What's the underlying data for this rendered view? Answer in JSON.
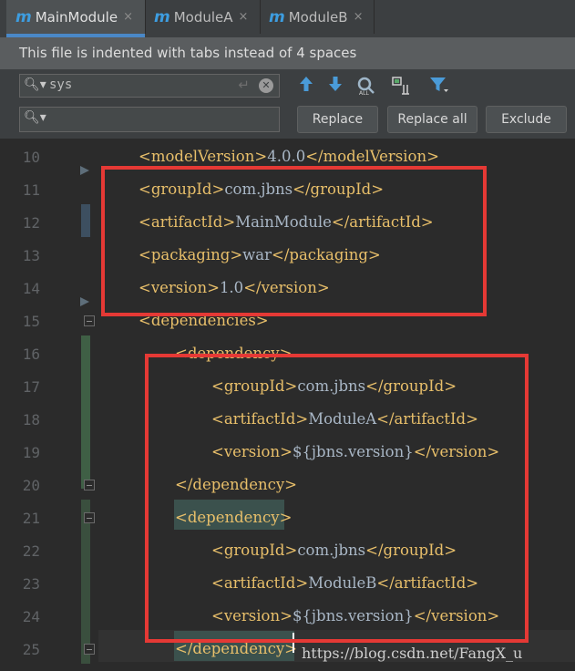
{
  "tabs": [
    {
      "name": "MainModule",
      "icon": "m-module-icon",
      "active": true
    },
    {
      "name": "ModuleA",
      "icon": "m-module-icon",
      "active": false
    },
    {
      "name": "ModuleB",
      "icon": "m-module-icon",
      "active": false
    }
  ],
  "tab_close_glyph": "×",
  "tab_module_glyph": "m",
  "banner": {
    "text": "This file is indented with tabs instead of 4 spaces"
  },
  "search": {
    "value": "sys",
    "placeholder": ""
  },
  "replace": {
    "value": "",
    "placeholder": ""
  },
  "buttons": {
    "replace": "Replace",
    "replace_all": "Replace all",
    "exclude": "Exclude"
  },
  "toolbar_icons": [
    "arrow-up-icon",
    "arrow-down-icon",
    "find-all-icon",
    "select-all-occurrences-icon",
    "filter-icon"
  ],
  "lines": [
    {
      "no": "10",
      "parts": [
        [
          "tag",
          "<modelVersion>"
        ],
        [
          "val",
          "4.0.0"
        ],
        [
          "tag",
          "</modelVersion>"
        ]
      ]
    },
    {
      "no": "11",
      "parts": [
        [
          "tag",
          "<groupId>"
        ],
        [
          "val",
          "com.jbns"
        ],
        [
          "tag",
          "</groupId>"
        ]
      ]
    },
    {
      "no": "12",
      "parts": [
        [
          "tag",
          "<artifactId>"
        ],
        [
          "val",
          "MainModule"
        ],
        [
          "tag",
          "</artifactId>"
        ]
      ]
    },
    {
      "no": "13",
      "parts": [
        [
          "tag",
          "<packaging>"
        ],
        [
          "val",
          "war"
        ],
        [
          "tag",
          "</packaging>"
        ]
      ]
    },
    {
      "no": "14",
      "parts": [
        [
          "tag",
          "<version>"
        ],
        [
          "val",
          "1.0"
        ],
        [
          "tag",
          "</version>"
        ]
      ]
    },
    {
      "no": "15",
      "parts": [
        [
          "tag",
          "<dependencies>"
        ]
      ]
    },
    {
      "no": "16",
      "parts": [
        [
          "tag",
          "<dependency>"
        ]
      ]
    },
    {
      "no": "17",
      "parts": [
        [
          "tag",
          "<groupId>"
        ],
        [
          "val",
          "com.jbns"
        ],
        [
          "tag",
          "</groupId>"
        ]
      ]
    },
    {
      "no": "18",
      "parts": [
        [
          "tag",
          "<artifactId>"
        ],
        [
          "val",
          "ModuleA"
        ],
        [
          "tag",
          "</artifactId>"
        ]
      ]
    },
    {
      "no": "19",
      "parts": [
        [
          "tag",
          "<version>"
        ],
        [
          "val",
          "${jbns.version}"
        ],
        [
          "tag",
          "</version>"
        ]
      ]
    },
    {
      "no": "20",
      "parts": [
        [
          "tag",
          "</dependency>"
        ]
      ]
    },
    {
      "no": "21",
      "parts": [
        [
          "tag",
          "<dependency>"
        ]
      ]
    },
    {
      "no": "22",
      "parts": [
        [
          "tag",
          "<groupId>"
        ],
        [
          "val",
          "com.jbns"
        ],
        [
          "tag",
          "</groupId>"
        ]
      ]
    },
    {
      "no": "23",
      "parts": [
        [
          "tag",
          "<artifactId>"
        ],
        [
          "val",
          "ModuleB"
        ],
        [
          "tag",
          "</artifactId>"
        ]
      ]
    },
    {
      "no": "24",
      "parts": [
        [
          "tag",
          "<version>"
        ],
        [
          "val",
          "${jbns.version}"
        ],
        [
          "tag",
          "</version>"
        ]
      ]
    },
    {
      "no": "25",
      "parts": [
        [
          "tag",
          "</dependency>"
        ]
      ]
    }
  ],
  "watermark": "https://blog.csdn.net/FangX_u",
  "colors": {
    "tag": "#e8bf6a",
    "text": "#a9b7c6",
    "highlight_box": "#e53935",
    "tab_accent": "#4a88c7"
  }
}
